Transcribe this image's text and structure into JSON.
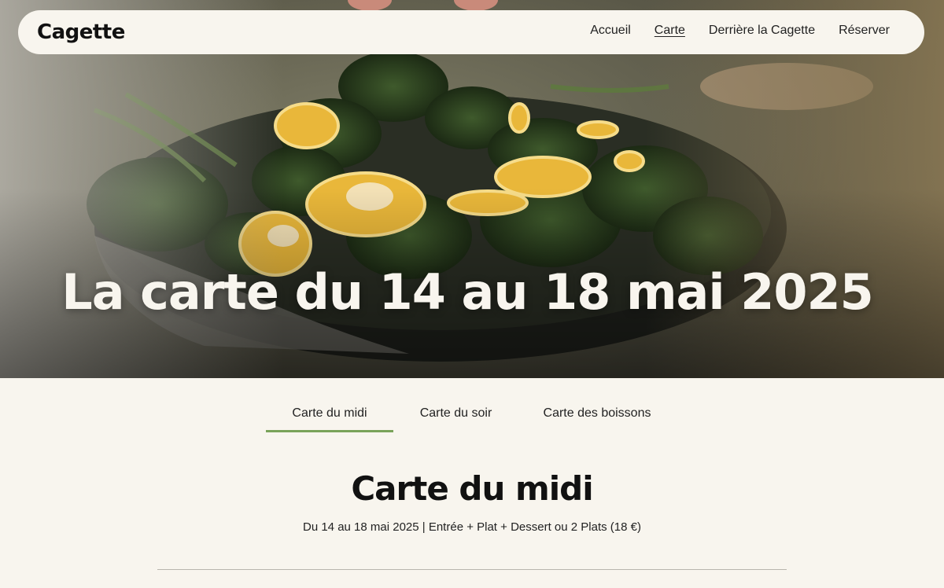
{
  "header": {
    "logo": "Cagette",
    "nav": [
      {
        "label": "Accueil",
        "active": false
      },
      {
        "label": "Carte",
        "active": true
      },
      {
        "label": "Derrière la Cagette",
        "active": false
      },
      {
        "label": "Réserver",
        "active": false
      }
    ]
  },
  "hero": {
    "title": "La carte du 14 au 18 mai 2025",
    "image": "photo of a pan of roasted broccolini with lemon slices"
  },
  "tabs": [
    {
      "label": "Carte du midi",
      "active": true
    },
    {
      "label": "Carte du soir",
      "active": false
    },
    {
      "label": "Carte des boissons",
      "active": false
    }
  ],
  "menu": {
    "title": "Carte du midi",
    "subtitle": "Du 14 au 18 mai 2025 | Entrée + Plat + Dessert ou 2 Plats (18 €)"
  },
  "colors": {
    "background": "#f8f5ee",
    "accent": "#79a35a",
    "text": "#1e1e1e"
  }
}
